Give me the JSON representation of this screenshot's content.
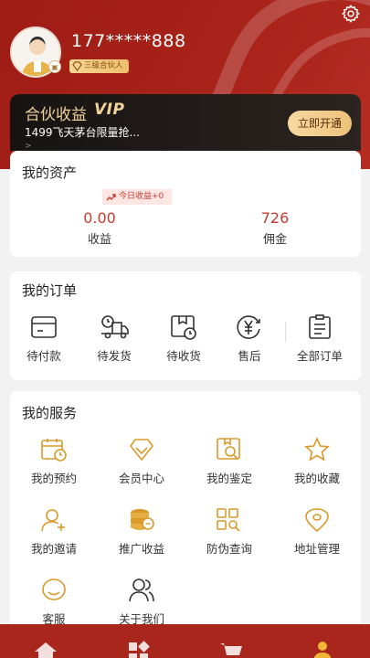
{
  "user": {
    "phone": "177*****888",
    "level": "三级合伙人"
  },
  "vip": {
    "title": "合伙收益",
    "logo": "VIP",
    "subtitle": "1499飞天茅台限量抢...",
    "arrow": ">",
    "button": "立即开通"
  },
  "assets": {
    "title": "我的资产",
    "today_tag": "今日收益+0",
    "items": [
      {
        "value": "0.00",
        "label": "收益"
      },
      {
        "value": "726",
        "label": "佣金"
      }
    ]
  },
  "orders": {
    "title": "我的订单",
    "items": [
      {
        "label": "待付款",
        "icon": "wallet-icon"
      },
      {
        "label": "待发货",
        "icon": "truck-icon"
      },
      {
        "label": "待收货",
        "icon": "package-clock-icon"
      },
      {
        "label": "售后",
        "icon": "yen-refund-icon"
      },
      {
        "label": "全部订单",
        "icon": "clipboard-list-icon"
      }
    ]
  },
  "services": {
    "title": "我的服务",
    "items": [
      {
        "label": "我的预约",
        "icon": "calendar-clock-icon"
      },
      {
        "label": "会员中心",
        "icon": "diamond-icon"
      },
      {
        "label": "我的鉴定",
        "icon": "image-search-icon"
      },
      {
        "label": "我的收藏",
        "icon": "star-icon"
      },
      {
        "label": "我的邀请",
        "icon": "user-add-icon"
      },
      {
        "label": "推广收益",
        "icon": "coins-icon"
      },
      {
        "label": "防伪查询",
        "icon": "qr-search-icon"
      },
      {
        "label": "地址管理",
        "icon": "location-pin-icon"
      },
      {
        "label": "客服",
        "icon": "headset-icon"
      },
      {
        "label": "关于我们",
        "icon": "users-icon"
      }
    ]
  },
  "tabbar": {
    "items": [
      {
        "icon": "home-icon"
      },
      {
        "icon": "category-icon"
      },
      {
        "icon": "cart-icon"
      },
      {
        "icon": "profile-icon"
      }
    ]
  },
  "colors": {
    "brand_red": "#a8231a",
    "accent_gold": "#d99a2b",
    "value_red": "#c43c2f"
  }
}
